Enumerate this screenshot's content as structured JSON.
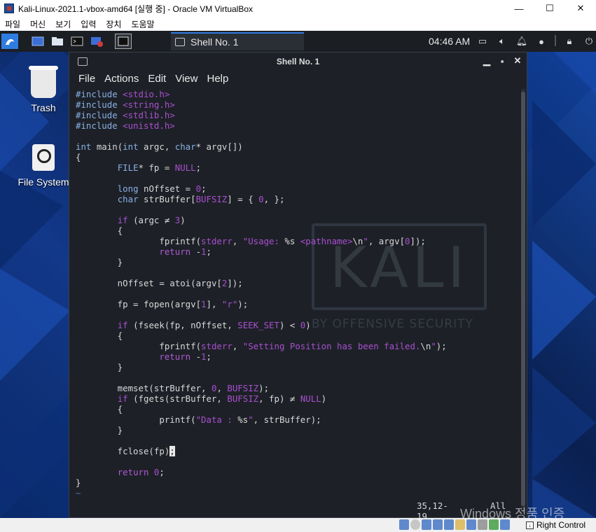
{
  "host_window": {
    "title": "Kali-Linux-2021.1-vbox-amd64 [실행 중] - Oracle VM VirtualBox",
    "controls": {
      "minimize": "—",
      "maximize": "☐",
      "close": "✕"
    },
    "menu": [
      "파일",
      "머신",
      "보기",
      "입력",
      "장치",
      "도움말"
    ]
  },
  "kali_panel": {
    "task_label": "Shell No. 1",
    "clock": "04:46 AM"
  },
  "desktop_icons": {
    "trash": "Trash",
    "filesystem": "File System"
  },
  "terminal": {
    "title": "Shell No. 1",
    "menu": [
      "File",
      "Actions",
      "Edit",
      "View",
      "Help"
    ],
    "status_position": "35,12-19",
    "status_scope": "All"
  },
  "watermark": {
    "line": "Windows 정품 인증"
  },
  "statusbar": {
    "host_key": "Right Control"
  },
  "background_logo": {
    "big": "KALI",
    "sub": "BY OFFENSIVE SECURITY"
  }
}
